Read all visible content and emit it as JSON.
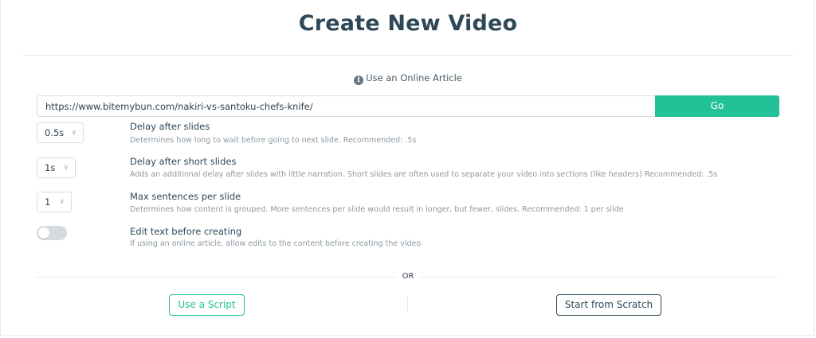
{
  "page": {
    "title": "Create New Video"
  },
  "article": {
    "heading": "Use an Online Article",
    "url_value": "https://www.bitemybun.com/nakiri-vs-santoku-chefs-knife/",
    "go_label": "Go"
  },
  "options": {
    "delay_slides": {
      "value": "0.5s",
      "title": "Delay after slides",
      "description": "Determines how long to wait before going to next slide. Recommended: .5s"
    },
    "delay_short": {
      "value": "1s",
      "title": "Delay after short slides",
      "description": "Adds an additional delay after slides with little narration. Short slides are often used to separate your video into sections (like headers) Recommended: .5s"
    },
    "max_sentences": {
      "value": "1",
      "title": "Max sentences per slide",
      "description": "Determines how content is grouped. More sentences per slide would result in longer, but fewer, slides. Recommended: 1 per slide"
    },
    "edit_text": {
      "enabled": false,
      "title": "Edit text before creating",
      "description": "If using an online article, allow edits to the content before creating the video"
    }
  },
  "divider": {
    "or_label": "OR"
  },
  "actions": {
    "script_label": "Use a Script",
    "scratch_label": "Start from Scratch"
  },
  "colors": {
    "accent": "#22c197",
    "primary_text": "#2f4858",
    "muted_text": "#8c98a1"
  }
}
